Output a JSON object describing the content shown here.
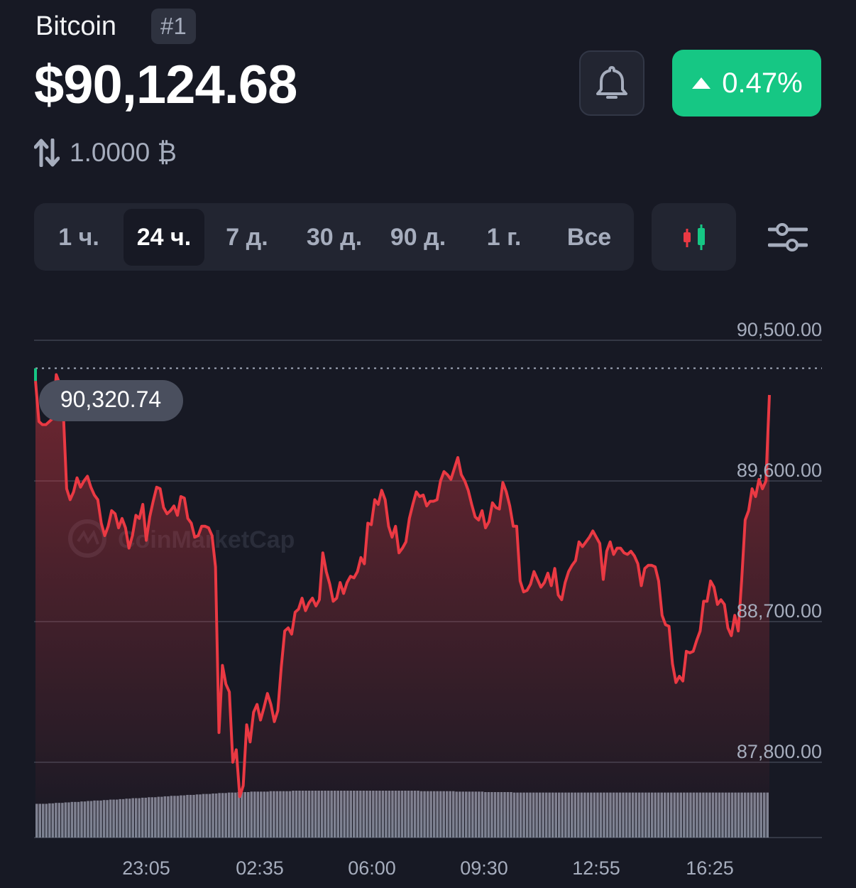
{
  "coin": {
    "name": "Bitcoin",
    "rank": "#1",
    "price": "$90,124.68",
    "change": "0.47%",
    "conversion": "1.0000 ₿"
  },
  "ranges": [
    "1 ч.",
    "24 ч.",
    "7 д.",
    "30 д.",
    "90 д.",
    "1 г.",
    "Все"
  ],
  "active_range": "24 ч.",
  "colors": {
    "background": "#171924",
    "up": "#16c784",
    "down": "#ea3943",
    "panel": "#222531"
  },
  "icons": {
    "bell": "bell-icon",
    "conversion": "swap-arrows-icon",
    "candles": "candlestick-icon",
    "settings": "sliders-icon"
  },
  "watermark": "CoinMarketCap",
  "chart_data": {
    "type": "line",
    "y_ticks": [
      "90,500.00",
      "89,600.00",
      "88,700.00",
      "87,800.00"
    ],
    "y_tick_values": [
      90500,
      89600,
      88700,
      87800
    ],
    "ylim": [
      87800,
      90500
    ],
    "x_ticks": [
      "23:05",
      "02:35",
      "06:00",
      "09:30",
      "12:55",
      "16:25"
    ],
    "reference_value": 90320.74,
    "reference_label": "90,320.74",
    "grid": true,
    "values": [
      90240,
      89980,
      89960,
      89960,
      89980,
      90000,
      90280,
      90220,
      90060,
      89550,
      89480,
      89530,
      89620,
      89560,
      89600,
      89630,
      89560,
      89510,
      89480,
      89330,
      89250,
      89310,
      89410,
      89390,
      89300,
      89360,
      89300,
      89170,
      89250,
      89380,
      89360,
      89450,
      89220,
      89370,
      89470,
      89560,
      89550,
      89430,
      89390,
      89410,
      89440,
      89380,
      89500,
      89490,
      89360,
      89330,
      89240,
      89250,
      89310,
      89310,
      89300,
      89250,
      89050,
      87990,
      88420,
      88300,
      88250,
      87800,
      87880,
      87580,
      87650,
      88040,
      87930,
      88120,
      88170,
      88070,
      88150,
      88240,
      88170,
      88060,
      88130,
      88410,
      88640,
      88660,
      88620,
      88760,
      88780,
      88850,
      88770,
      88820,
      88850,
      88800,
      88840,
      89140,
      89020,
      88940,
      88830,
      88850,
      88950,
      88880,
      88950,
      88990,
      88980,
      89020,
      89110,
      89070,
      89330,
      89320,
      89480,
      89450,
      89540,
      89480,
      89310,
      89240,
      89310,
      89140,
      89170,
      89210,
      89360,
      89450,
      89530,
      89500,
      89510,
      89440,
      89470,
      89470,
      89480,
      89600,
      89660,
      89640,
      89610,
      89680,
      89750,
      89640,
      89600,
      89540,
      89450,
      89370,
      89350,
      89410,
      89300,
      89340,
      89460,
      89430,
      89420,
      89590,
      89530,
      89440,
      89310,
      89310,
      88960,
      88890,
      88900,
      88940,
      89020,
      88970,
      88920,
      88950,
      89010,
      88930,
      89040,
      88870,
      88840,
      88950,
      89020,
      89060,
      89090,
      89210,
      89180,
      89210,
      89240,
      89280,
      89240,
      89200,
      88970,
      89150,
      89210,
      89130,
      89170,
      89170,
      89140,
      89130,
      89150,
      89120,
      89070,
      88930,
      89040,
      89060,
      89060,
      89050,
      88960,
      88740,
      88680,
      88670,
      88430,
      88310,
      88350,
      88320,
      88510,
      88500,
      88510,
      88580,
      88640,
      88830,
      88830,
      88960,
      88920,
      88810,
      88840,
      88810,
      88660,
      88610,
      88740,
      88640,
      88970,
      89350,
      89410,
      89550,
      89500,
      89610,
      89550,
      89600,
      90150
    ],
    "volume": [
      0.72,
      0.72,
      0.72,
      0.72,
      0.73,
      0.73,
      0.74,
      0.74,
      0.74,
      0.75,
      0.75,
      0.76,
      0.76,
      0.76,
      0.77,
      0.77,
      0.78,
      0.78,
      0.79,
      0.79,
      0.79,
      0.8,
      0.8,
      0.81,
      0.81,
      0.81,
      0.82,
      0.82,
      0.83,
      0.83,
      0.84,
      0.84,
      0.84,
      0.85,
      0.85,
      0.86,
      0.86,
      0.86,
      0.87,
      0.87,
      0.88,
      0.88,
      0.89,
      0.89,
      0.89,
      0.9,
      0.9,
      0.91,
      0.91,
      0.91,
      0.92,
      0.92,
      0.93,
      0.93,
      0.93,
      0.94,
      0.94,
      0.95,
      0.95,
      0.95,
      0.96,
      0.96,
      0.96,
      0.97,
      0.97,
      0.97,
      0.97,
      0.98,
      0.98,
      0.98,
      0.98,
      0.98,
      0.98,
      0.99,
      0.99,
      0.99,
      0.99,
      0.99,
      0.99,
      0.99,
      1,
      1,
      1,
      1,
      1,
      1,
      1,
      1,
      1,
      1,
      1,
      1,
      1,
      1,
      1,
      1,
      1,
      1,
      1,
      1,
      1,
      1,
      1,
      1,
      1,
      1,
      1,
      1,
      1,
      1,
      1,
      1,
      1,
      1,
      1,
      1,
      1,
      1,
      1,
      1,
      0.99,
      0.99,
      0.99,
      0.99,
      0.99,
      0.99,
      0.99,
      0.99,
      0.99,
      0.99,
      0.99,
      0.98,
      0.98,
      0.98,
      0.98,
      0.98,
      0.98,
      0.98,
      0.98,
      0.98,
      0.97,
      0.97,
      0.97,
      0.97,
      0.97,
      0.97,
      0.97,
      0.97,
      0.97,
      0.96,
      0.96,
      0.96,
      0.96,
      0.96,
      0.96,
      0.96,
      0.96,
      0.96,
      0.96,
      0.96,
      0.96,
      0.96,
      0.96,
      0.96,
      0.96,
      0.96,
      0.96,
      0.96,
      0.96,
      0.96,
      0.96,
      0.96,
      0.96,
      0.96,
      0.96,
      0.96,
      0.96,
      0.96,
      0.96,
      0.96,
      0.96,
      0.96,
      0.96,
      0.96,
      0.96,
      0.96,
      0.96,
      0.96,
      0.96,
      0.96,
      0.96,
      0.96,
      0.96,
      0.96,
      0.96,
      0.96,
      0.96,
      0.96,
      0.96,
      0.96,
      0.96,
      0.96,
      0.96,
      0.96,
      0.96,
      0.96,
      0.96,
      0.96,
      0.96,
      0.96,
      0.96,
      0.96,
      0.96,
      0.96,
      0.96,
      0.96,
      0.96,
      0.96,
      0.96,
      0.96,
      0.96,
      0.96,
      0.96,
      0.96,
      0.96,
      0.96,
      0.96,
      0.96,
      0.96
    ]
  }
}
